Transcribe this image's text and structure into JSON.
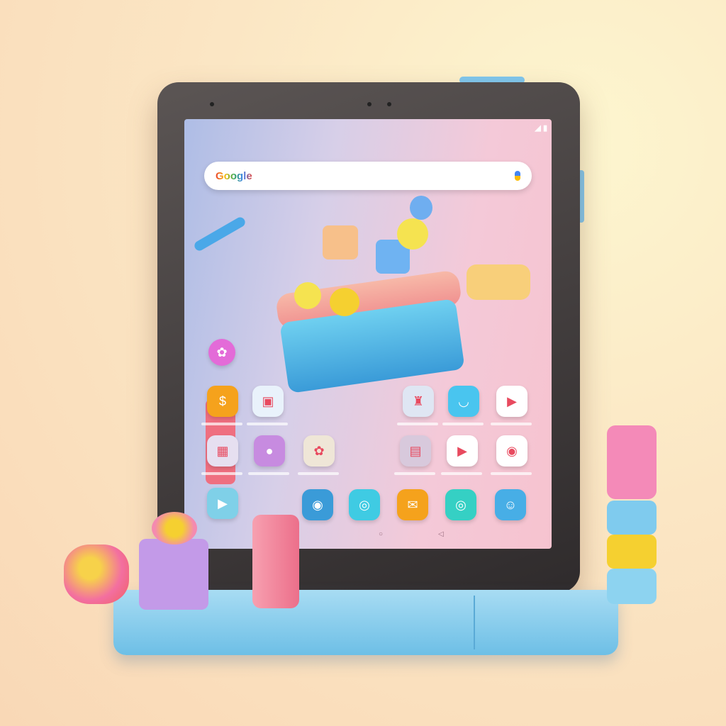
{
  "search": {
    "logo": "Google"
  },
  "apps": [
    {
      "name": "wallet",
      "glyph": "$",
      "color": "#f5a21c"
    },
    {
      "name": "photos",
      "glyph": "▣",
      "color": "#e9f2fb"
    },
    {
      "name": "assistant",
      "glyph": "♜",
      "color": "#dfe6f3"
    },
    {
      "name": "chat",
      "glyph": "◡",
      "color": "#49c5ef"
    },
    {
      "name": "play-store",
      "glyph": "▶",
      "color": "#ffffff"
    },
    {
      "name": "gallery",
      "glyph": "▦",
      "color": "#e6dff0"
    },
    {
      "name": "messages",
      "glyph": "●",
      "color": "#c78be0"
    },
    {
      "name": "games",
      "glyph": "✿",
      "color": "#efe6d7"
    },
    {
      "name": "kids",
      "glyph": "▤",
      "color": "#d8c9dc"
    },
    {
      "name": "youtube",
      "glyph": "▶",
      "color": "#ffffff"
    },
    {
      "name": "chrome",
      "glyph": "◉",
      "color": "#ffffff"
    },
    {
      "name": "video",
      "glyph": "▶",
      "color": "#7fd0e8"
    },
    {
      "name": "camera",
      "glyph": "◉",
      "color": "#3a9bd8"
    },
    {
      "name": "settings",
      "glyph": "◎",
      "color": "#3fcbe3"
    },
    {
      "name": "mail",
      "glyph": "✉",
      "color": "#f5a21c"
    },
    {
      "name": "phone",
      "glyph": "◎",
      "color": "#35d0c4"
    },
    {
      "name": "contacts",
      "glyph": "☺",
      "color": "#47aee6"
    }
  ]
}
